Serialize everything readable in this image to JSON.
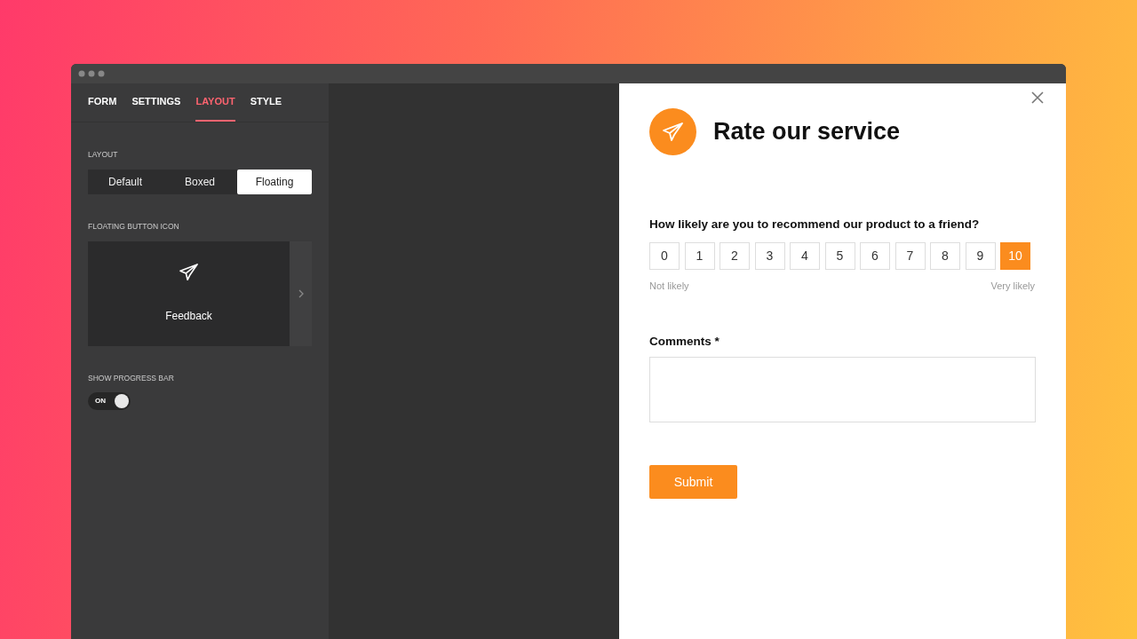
{
  "sidebar": {
    "tabs": [
      {
        "label": "FORM",
        "selected": false
      },
      {
        "label": "SETTINGS",
        "selected": false
      },
      {
        "label": "LAYOUT",
        "selected": true
      },
      {
        "label": "STYLE",
        "selected": false
      }
    ],
    "layout": {
      "label": "LAYOUT",
      "options": [
        {
          "label": "Default",
          "selected": false
        },
        {
          "label": "Boxed",
          "selected": false
        },
        {
          "label": "Floating",
          "selected": true
        }
      ]
    },
    "floating_icon": {
      "label": "FLOATING BUTTON ICON",
      "caption": "Feedback"
    },
    "progress_bar": {
      "label": "SHOW PROGRESS BAR",
      "toggle_text": "ON",
      "on": true
    }
  },
  "form": {
    "title": "Rate our service",
    "question": "How likely are you to recommend our product to a friend?",
    "scale": [
      {
        "label": "0",
        "selected": false
      },
      {
        "label": "1",
        "selected": false
      },
      {
        "label": "2",
        "selected": false
      },
      {
        "label": "3",
        "selected": false
      },
      {
        "label": "4",
        "selected": false
      },
      {
        "label": "5",
        "selected": false
      },
      {
        "label": "6",
        "selected": false
      },
      {
        "label": "7",
        "selected": false
      },
      {
        "label": "8",
        "selected": false
      },
      {
        "label": "9",
        "selected": false
      },
      {
        "label": "10",
        "selected": true
      }
    ],
    "low_label": "Not likely",
    "high_label": "Very likely",
    "comments_label": "Comments *",
    "submit": "Submit"
  }
}
